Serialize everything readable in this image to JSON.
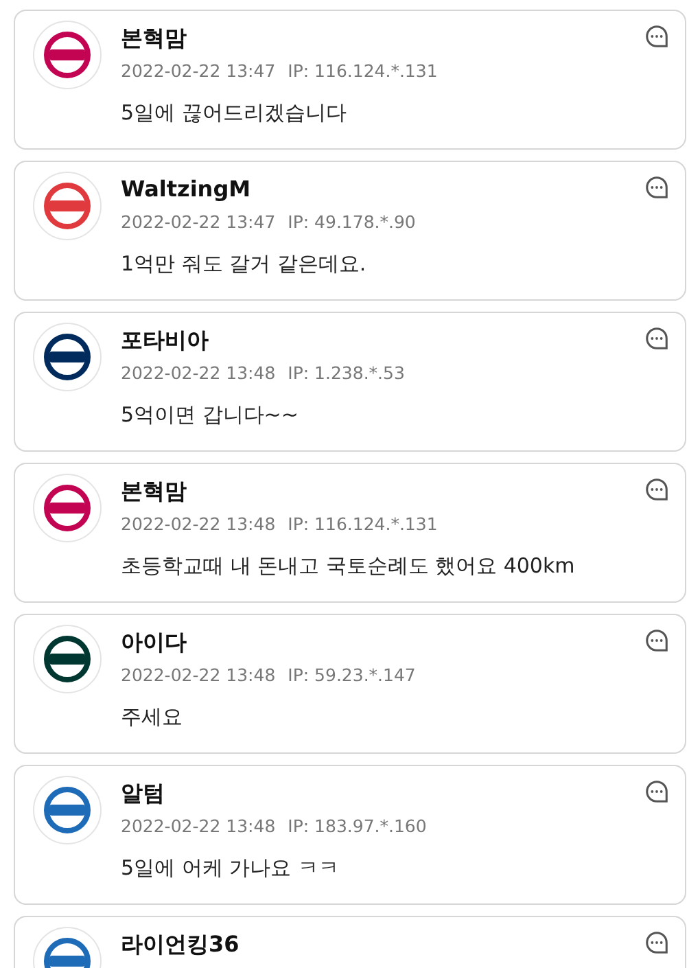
{
  "comments": [
    {
      "author": "본혁맘",
      "date": "2022-02-22 13:47",
      "ip": "IP: 116.124.*.131",
      "text": "5일에 끊어드리겠습니다",
      "color": "#c30452"
    },
    {
      "author": "WaltzingM",
      "date": "2022-02-22 13:47",
      "ip": "IP: 49.178.*.90",
      "text": "1억만 줘도 갈거 같은데요.",
      "color": "#e03a3e"
    },
    {
      "author": "포타비아",
      "date": "2022-02-22 13:48",
      "ip": "IP: 1.238.*.53",
      "text": "5억이면 갑니다~~",
      "color": "#002b5c"
    },
    {
      "author": "본혁맘",
      "date": "2022-02-22 13:48",
      "ip": "IP: 116.124.*.131",
      "text": "초등학교때 내 돈내고 국토순례도 했어요 400km",
      "color": "#c30452"
    },
    {
      "author": "아이다",
      "date": "2022-02-22 13:48",
      "ip": "IP: 59.23.*.147",
      "text": "주세요",
      "color": "#003831"
    },
    {
      "author": "알텀",
      "date": "2022-02-22 13:48",
      "ip": "IP: 183.97.*.160",
      "text": "5일에 어케 가나요 ㅋㅋ",
      "color": "#1e6bb8"
    },
    {
      "author": "라이언킹36",
      "color": "#1e6bb8"
    }
  ]
}
